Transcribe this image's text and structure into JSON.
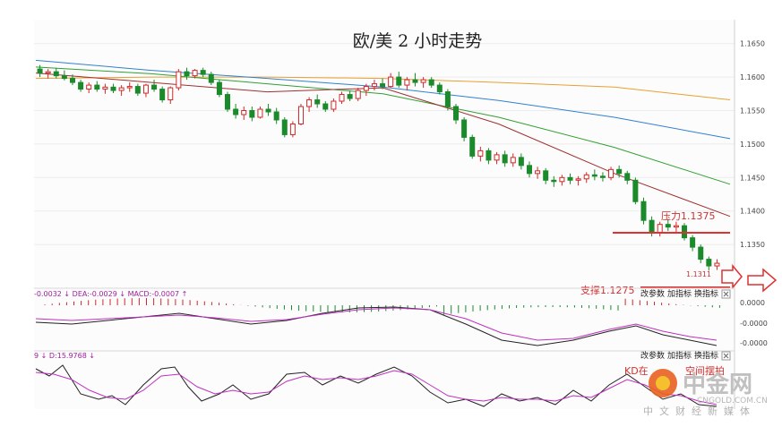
{
  "chart_data": {
    "type": "candlestick",
    "title": "欧/美 2 小时走势",
    "price_axis": {
      "ylim": [
        1.129,
        1.1675
      ],
      "ticks": [
        "1.1650",
        "1.1600",
        "1.1550",
        "1.1500",
        "1.1450",
        "1.1400",
        "1.1350"
      ]
    },
    "annotations": {
      "resistance_label": "压力1.1375",
      "resistance_value": 1.1375,
      "support_label": "支撑1.1275",
      "support_value": 1.1275,
      "low_label": "1.1311"
    },
    "candles_ohlc": [
      [
        1.1612,
        1.1618,
        1.16,
        1.1606
      ],
      [
        1.1606,
        1.1612,
        1.1598,
        1.1608
      ],
      [
        1.1608,
        1.1614,
        1.1598,
        1.1602
      ],
      [
        1.1602,
        1.161,
        1.1595,
        1.1598
      ],
      [
        1.1598,
        1.1604,
        1.1588,
        1.1592
      ],
      [
        1.1592,
        1.1596,
        1.1578,
        1.1582
      ],
      [
        1.1582,
        1.1592,
        1.1576,
        1.1588
      ],
      [
        1.1588,
        1.1594,
        1.1578,
        1.1582
      ],
      [
        1.1582,
        1.159,
        1.1575,
        1.1585
      ],
      [
        1.1585,
        1.159,
        1.1576,
        1.158
      ],
      [
        1.158,
        1.1588,
        1.1572,
        1.1584
      ],
      [
        1.1584,
        1.1592,
        1.1578,
        1.1586
      ],
      [
        1.1586,
        1.159,
        1.1572,
        1.1576
      ],
      [
        1.1576,
        1.159,
        1.157,
        1.1588
      ],
      [
        1.1588,
        1.1596,
        1.1578,
        1.1582
      ],
      [
        1.1582,
        1.1586,
        1.1562,
        1.1566
      ],
      [
        1.1566,
        1.1586,
        1.156,
        1.1584
      ],
      [
        1.1584,
        1.1612,
        1.158,
        1.1608
      ],
      [
        1.1608,
        1.1614,
        1.1596,
        1.1602
      ],
      [
        1.1602,
        1.1612,
        1.1598,
        1.161
      ],
      [
        1.161,
        1.1614,
        1.16,
        1.1604
      ],
      [
        1.1604,
        1.1608,
        1.1588,
        1.1592
      ],
      [
        1.1592,
        1.1596,
        1.157,
        1.1574
      ],
      [
        1.1574,
        1.1578,
        1.1548,
        1.1552
      ],
      [
        1.1552,
        1.156,
        1.1538,
        1.1544
      ],
      [
        1.1544,
        1.1556,
        1.1536,
        1.155
      ],
      [
        1.155,
        1.1556,
        1.1534,
        1.154
      ],
      [
        1.154,
        1.1556,
        1.1538,
        1.1552
      ],
      [
        1.1552,
        1.156,
        1.1542,
        1.1548
      ],
      [
        1.1548,
        1.1554,
        1.153,
        1.1536
      ],
      [
        1.1536,
        1.154,
        1.151,
        1.1514
      ],
      [
        1.1514,
        1.1534,
        1.151,
        1.153
      ],
      [
        1.153,
        1.156,
        1.1528,
        1.1556
      ],
      [
        1.1556,
        1.157,
        1.1548,
        1.1566
      ],
      [
        1.1566,
        1.1574,
        1.1554,
        1.156
      ],
      [
        1.156,
        1.1564,
        1.1548,
        1.1552
      ],
      [
        1.1552,
        1.1568,
        1.1548,
        1.1564
      ],
      [
        1.1564,
        1.1578,
        1.156,
        1.1574
      ],
      [
        1.1574,
        1.158,
        1.1564,
        1.1568
      ],
      [
        1.1568,
        1.1584,
        1.1564,
        1.158
      ],
      [
        1.158,
        1.159,
        1.1572,
        1.1586
      ],
      [
        1.1586,
        1.1596,
        1.158,
        1.159
      ],
      [
        1.159,
        1.1598,
        1.1582,
        1.1586
      ],
      [
        1.1586,
        1.1606,
        1.1584,
        1.16
      ],
      [
        1.16,
        1.1608,
        1.1584,
        1.1588
      ],
      [
        1.1588,
        1.16,
        1.158,
        1.1596
      ],
      [
        1.1596,
        1.1606,
        1.1586,
        1.1592
      ],
      [
        1.1592,
        1.16,
        1.1584,
        1.1596
      ],
      [
        1.1596,
        1.16,
        1.1584,
        1.1588
      ],
      [
        1.1588,
        1.1592,
        1.1574,
        1.1578
      ],
      [
        1.1578,
        1.1582,
        1.155,
        1.1556
      ],
      [
        1.1556,
        1.156,
        1.153,
        1.1536
      ],
      [
        1.1536,
        1.154,
        1.1504,
        1.151
      ],
      [
        1.151,
        1.1514,
        1.1478,
        1.1482
      ],
      [
        1.1482,
        1.1496,
        1.1474,
        1.149
      ],
      [
        1.149,
        1.1494,
        1.147,
        1.1476
      ],
      [
        1.1476,
        1.1488,
        1.147,
        1.1484
      ],
      [
        1.1484,
        1.149,
        1.1466,
        1.1472
      ],
      [
        1.1472,
        1.1486,
        1.1466,
        1.148
      ],
      [
        1.148,
        1.1486,
        1.1462,
        1.1468
      ],
      [
        1.1468,
        1.1474,
        1.145,
        1.1456
      ],
      [
        1.1456,
        1.1466,
        1.1448,
        1.146
      ],
      [
        1.146,
        1.1464,
        1.144,
        1.1446
      ],
      [
        1.1446,
        1.1452,
        1.1436,
        1.1444
      ],
      [
        1.1444,
        1.1454,
        1.1438,
        1.145
      ],
      [
        1.145,
        1.1456,
        1.144,
        1.1446
      ],
      [
        1.1446,
        1.1452,
        1.1438,
        1.1448
      ],
      [
        1.1448,
        1.1458,
        1.1442,
        1.1454
      ],
      [
        1.1454,
        1.1462,
        1.1446,
        1.1452
      ],
      [
        1.1452,
        1.1458,
        1.1444,
        1.145
      ],
      [
        1.145,
        1.1466,
        1.1446,
        1.1462
      ],
      [
        1.1462,
        1.1468,
        1.145,
        1.1456
      ],
      [
        1.1456,
        1.146,
        1.144,
        1.1446
      ],
      [
        1.1446,
        1.145,
        1.141,
        1.1414
      ],
      [
        1.1414,
        1.142,
        1.138,
        1.1386
      ],
      [
        1.1386,
        1.1392,
        1.1362,
        1.1368
      ],
      [
        1.1368,
        1.1384,
        1.1362,
        1.138
      ],
      [
        1.138,
        1.1388,
        1.137,
        1.1376
      ],
      [
        1.1376,
        1.1384,
        1.1368,
        1.1378
      ],
      [
        1.1378,
        1.1382,
        1.1356,
        1.136
      ],
      [
        1.136,
        1.1364,
        1.134,
        1.1346
      ],
      [
        1.1346,
        1.135,
        1.1322,
        1.1328
      ],
      [
        1.1328,
        1.1332,
        1.1311,
        1.1318
      ],
      [
        1.1318,
        1.1328,
        1.1312,
        1.1322
      ]
    ],
    "moving_averages": [
      {
        "color": "#e8a030",
        "values": [
          1.1598,
          1.16,
          1.16,
          1.1598,
          1.1592,
          1.1585,
          1.1566
        ]
      },
      {
        "color": "#3080d0",
        "values": [
          1.1625,
          1.161,
          1.1598,
          1.1585,
          1.1565,
          1.154,
          1.1508
        ]
      },
      {
        "color": "#30a030",
        "values": [
          1.1615,
          1.1605,
          1.159,
          1.1575,
          1.154,
          1.1495,
          1.144
        ]
      },
      {
        "color": "#a03030",
        "values": [
          1.1606,
          1.1592,
          1.1578,
          1.1584,
          1.153,
          1.1456,
          1.1392
        ]
      }
    ],
    "macd_panel": {
      "header": "-0.0032 ↓ DEA:-0.0029 ↓ MACD:-0.0007 ↑",
      "ticks": [
        "0.0000",
        "-0.0000",
        "-0.0000"
      ],
      "buttons": [
        "改参数",
        "加指标",
        "换指标"
      ]
    },
    "kd_panel": {
      "header": "9 ↓ D:15.9768 ↓",
      "overlay_text": "KD在",
      "overlay_text_2": "空间摆拍",
      "buttons": [
        "改参数",
        "加指标",
        "换指标"
      ]
    },
    "watermark": {
      "brand": "中金网",
      "url": "CNGOLD.COM.CN",
      "slogan": "中文财经新媒体"
    }
  }
}
